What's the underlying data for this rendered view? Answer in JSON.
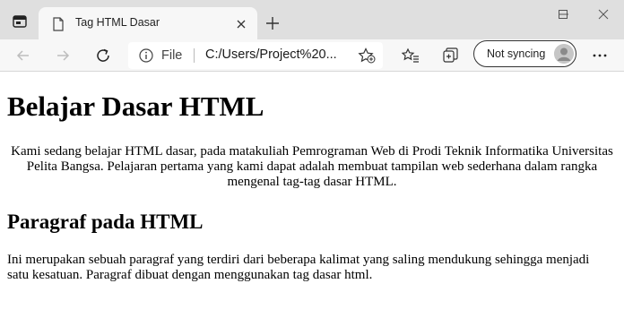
{
  "browser": {
    "tab_title": "Tag HTML Dasar",
    "site_label": "File",
    "url": "C:/Users/Project%20...",
    "sync_label": "Not syncing"
  },
  "icons": {
    "window_menu": "window-menu-icon",
    "tab_favicon": "file-page-icon",
    "tab_close": "close-icon",
    "new_tab": "plus-icon",
    "minimize": "minimize-icon",
    "maximize": "maximize-icon",
    "close_window": "close-icon",
    "back": "arrow-left-icon",
    "forward": "arrow-right-icon",
    "refresh": "refresh-icon",
    "site_info": "info-icon",
    "add_favorite": "star-plus-icon",
    "favorites": "star-list-icon",
    "collections": "collections-icon",
    "avatar": "user-avatar-icon",
    "more": "ellipsis-icon"
  },
  "page": {
    "heading": "Belajar Dasar HTML",
    "intro": "Kami sedang belajar HTML dasar, pada matakuliah Pemrograman Web di Prodi Teknik Informatika Universitas Pelita Bangsa. Pelajaran pertama yang kami dapat adalah membuat tampilan web sederhana dalam rangka mengenal tag-tag dasar HTML.",
    "subheading": "Paragraf pada HTML",
    "paragraph": "Ini merupakan sebuah paragraf yang terdiri dari beberapa kalimat yang saling mendukung sehingga menjadi satu kesatuan. Paragraf dibuat dengan menggunakan tag dasar html."
  }
}
